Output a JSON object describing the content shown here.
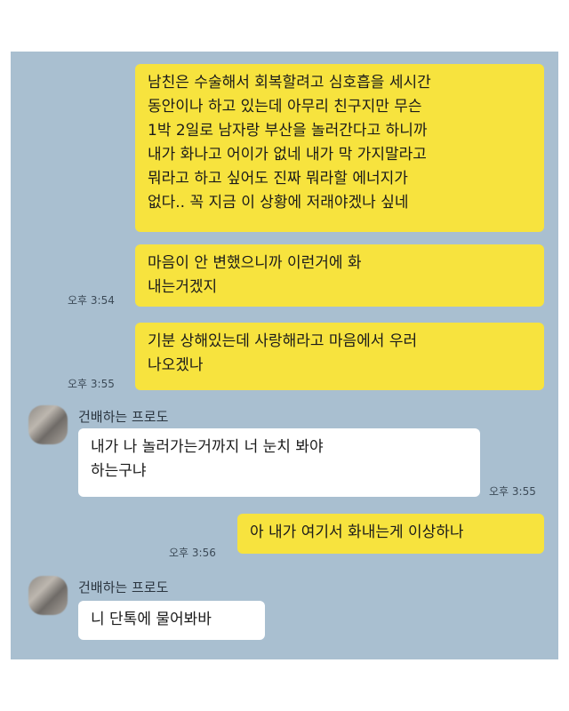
{
  "chat": {
    "contact_name": "건배하는 프로도",
    "messages": [
      {
        "sender": "me",
        "text": "남친은 수술해서 회복할려고 심호흡을 세시간\n동안이나 하고 있는데 아무리 친구지만 무슨\n1박 2일로 남자랑 부산을 놀러간다고 하니까\n내가 화나고 어이가 없네 내가 막 가지말라고\n뭐라고 하고 싶어도 진짜 뭐라할 에너지가\n없다.. 꼭 지금 이 상황에 저래야겠나 싶네",
        "time": ""
      },
      {
        "sender": "me",
        "text": "마음이 안 변했으니까 이런거에 화\n내는거겠지",
        "time": "오후 3:54"
      },
      {
        "sender": "me",
        "text": "기분 상해있는데 사랑해라고 마음에서 우러\n나오겠나",
        "time": "오후 3:55"
      },
      {
        "sender": "them",
        "text": "내가 나 놀러가는거까지 너 눈치 봐야\n하는구냐",
        "time": "오후 3:55"
      },
      {
        "sender": "me",
        "text": "아 내가 여기서 화내는게 이상하나",
        "time": "오후 3:56"
      },
      {
        "sender": "them",
        "text": "니 단톡에 물어봐바",
        "time": ""
      }
    ]
  },
  "colors": {
    "background": "#a9bfd0",
    "my_bubble": "#f7e33e",
    "their_bubble": "#ffffff"
  },
  "icons": {
    "avatar": "blurred-profile-avatar"
  }
}
